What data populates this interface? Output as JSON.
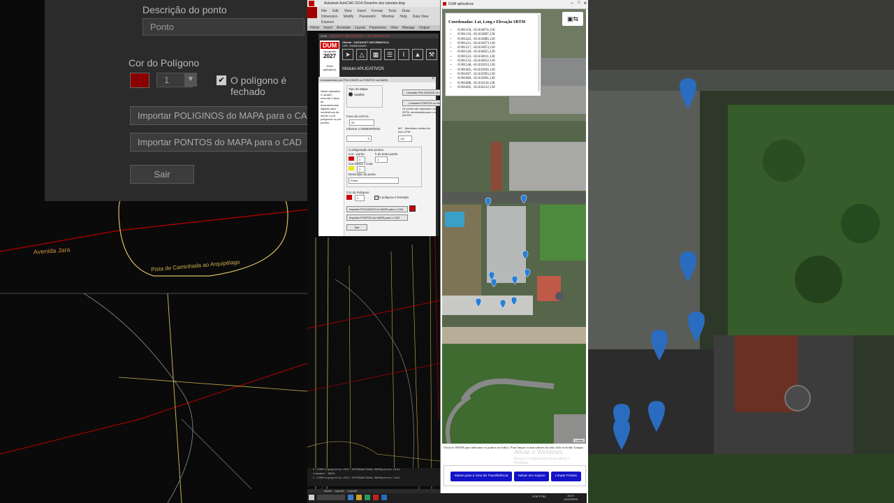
{
  "left_dialog": {
    "description_label": "Descrição do ponto",
    "description_value": "Ponto",
    "polygon_color_label": "Cor do Polígono",
    "polygon_size_value": "1",
    "polygon_closed_label": "O polígono é fechado",
    "import_polygons_btn": "Importar POLIGINOS do MAPA para o CAD",
    "import_points_btn": "Importar PONTOS do MAPA para o CAD",
    "exit_btn": "Sair"
  },
  "cad_labels": {
    "road1": "Avenida Jara",
    "road2": "Pista de Caminhada ao Arquipélago"
  },
  "acad": {
    "title": "Autodesk AutoCAD 2014  Desenho dos tutoriais.dwg",
    "menu_row1": [
      "File",
      "Edit",
      "View",
      "Insert",
      "Format",
      "Tools",
      "Draw"
    ],
    "menu_row2": [
      "Dimension",
      "Modify",
      "Parametric",
      "Window",
      "Help",
      "Data View"
    ],
    "menu_row3": [
      "Express"
    ],
    "ribbon": [
      "Home",
      "Insert",
      "Annotate",
      "Layout",
      "Parametric",
      "View",
      "Manage",
      "Output"
    ],
    "doc_tab": "DUM",
    "company_tab": "DATASOFT INFORMÁTICA - CPF:00000000000",
    "command_lines": [
      "C:\\DUM\\topografia-2027-INTERNACIONAL\\MAPApontos.html",
      "Command: MAPA",
      "C:\\DUM\\topografia-2027-INTERNACIONAL\\MAPApontos.html"
    ],
    "layout_tabs": [
      "Model",
      "Layout1",
      "Layout2"
    ]
  },
  "dum": {
    "logo": "DUM",
    "logo_sub": "topografia",
    "year": "2027",
    "app_name": "DUM aplicativos",
    "client_line1": "Cliente : DATASOFT INFORMATICA",
    "client_line2": "CPF: 00000000000",
    "module_label": "Módulo APLICATIVOS",
    "subwindow_title": "Levantamento por POLIGINOS ou PONTOS via MAPA",
    "side_text": "Neste aplicativo o usuário executa 2 tipos de levantamentos digitais para conferência de, sendo o por polígonos ou por pontos.",
    "map_type_label": "Tipo de Mapa",
    "map_type_value": "Satélite",
    "btn_polygons": "Levantar POLIGONOS no MAPA",
    "btn_points": "Levantar PONTOS no MAPA",
    "points_note": "Os pontos são capturados com a cota SRTM, arredondada para o metro mais próximo",
    "fuso_label": "Fuso do LOCAL",
    "fuso_value": "20",
    "hemisferio_label": "Informe o HEMISFÉRIO",
    "hemisferio_value": "S",
    "mc_label": "MC - Meridiano central do fuso UTM",
    "mc_value": "-63",
    "points_config_label": "Configuração dos pontos",
    "cor_ponto_label": "Cor - ponto",
    "h_texto_label": "h do texto ponto",
    "h_texto_value": "1",
    "ponto_size_value": "3",
    "cor_descr_label": "Cor Descr. / Cota",
    "descr_size_value": "2",
    "descricao_label": "Descrição do ponto",
    "descricao_value": "Ponto",
    "poly_color_label": "Cor do Polígono",
    "poly_size_value": "1",
    "poly_closed_label": "O polígono é fechado",
    "import_polys": "Importar POLIGINOS do MAPA para o CAD",
    "import_points": "Importar PONTOS do MAPA para o CAD",
    "exit": "Sair"
  },
  "browser": {
    "title": "DUM aplicativos",
    "popup_title": "Coordenadas: Lat, Long e Elevação SRTM",
    "coords": [
      "-9.901150, -63.034074,130",
      "-9.901143, -63.033887,130",
      "-9.901422, -63.033886,130",
      "-9.901421, -63.033873,130",
      "-9.901517, -63.033874,130",
      "-9.901520, -63.034055,130",
      "-9.901523, -63.034011,130",
      "-9.901533, -63.034052,130",
      "-9.901548, -63.033933,130",
      "-9.901665, -63.033936,130",
      "-9.901667, -63.033993,130",
      "-9.901689, -63.033991,130",
      "-9.901688, -63.034118,130",
      "-9.901665, -63.034122,130"
    ],
    "help_text": "Click no MAPA para adicionar os pontos na lotbox. Para limpar os marcadores da tela click no botão Limpar",
    "btn_transfer": "Salvar para a Área de Transferência",
    "btn_save_file": "Salvar em Arquivo",
    "btn_clear": "Limpar Pontos",
    "attribution": "Leaflet"
  },
  "watermark": {
    "line1": "Ativar o Windows",
    "line2": "Acesse Configurações para ativar o Windows."
  },
  "taskbar": {
    "lang": "POR PTB2",
    "time": "10:07",
    "date": "11/02/2026"
  },
  "colors": {
    "point_color": "#cc0000",
    "descr_color": "#e8e800",
    "polygon_color": "#cc0000",
    "button_blue": "#1313c8",
    "pin_blue": "#2a7fd6"
  }
}
